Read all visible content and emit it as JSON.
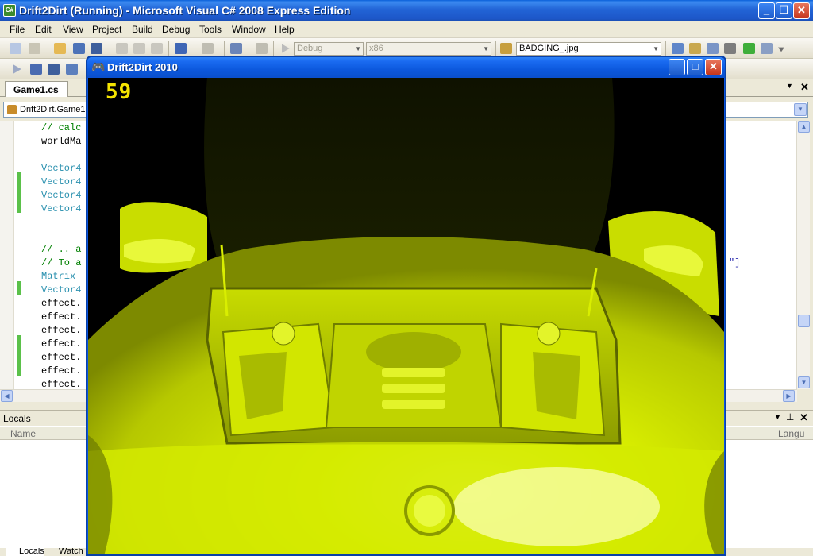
{
  "window": {
    "title": "Drift2Dirt (Running) - Microsoft Visual C# 2008 Express Edition",
    "icon_text": "C#",
    "minimize": "_",
    "restore": "❐",
    "close": "✕"
  },
  "menu": [
    "File",
    "Edit",
    "View",
    "Project",
    "Build",
    "Debug",
    "Tools",
    "Window",
    "Help"
  ],
  "toolbar": {
    "config": "Debug",
    "platform": "x86",
    "find_file": "BADGING_.jpg"
  },
  "tabs": {
    "active_document": "Game1.cs"
  },
  "editor": {
    "class_combo": "Drift2Dirt.Game1",
    "code_lines": [
      "// calc",
      "worldMa",
      "",
      "Vector4",
      "Vector4",
      "Vector4",
      "Vector4",
      "",
      "",
      "// .. a",
      "// To a",
      "Matrix ",
      "Vector4",
      "effect.",
      "effect.",
      "effect.",
      "effect.",
      "effect.",
      "effect.",
      "effect."
    ],
    "right_fragment": "\"]"
  },
  "locals": {
    "title": "Locals",
    "col_name": "Name",
    "col_lang": "Langu",
    "tab_locals": "Locals",
    "tab_watch": "Watch"
  },
  "game": {
    "title": "Drift2Dirt 2010",
    "fps": "59",
    "minimize": "_",
    "maximize": "□",
    "close": "✕"
  },
  "colors": {
    "car_body": "#d8f000",
    "car_shadow": "#6c7a00",
    "hud": "#f5e400",
    "code_comment": "#008000",
    "code_keyword_type": "#2b91af",
    "xp_blue": "#0b55e0"
  }
}
